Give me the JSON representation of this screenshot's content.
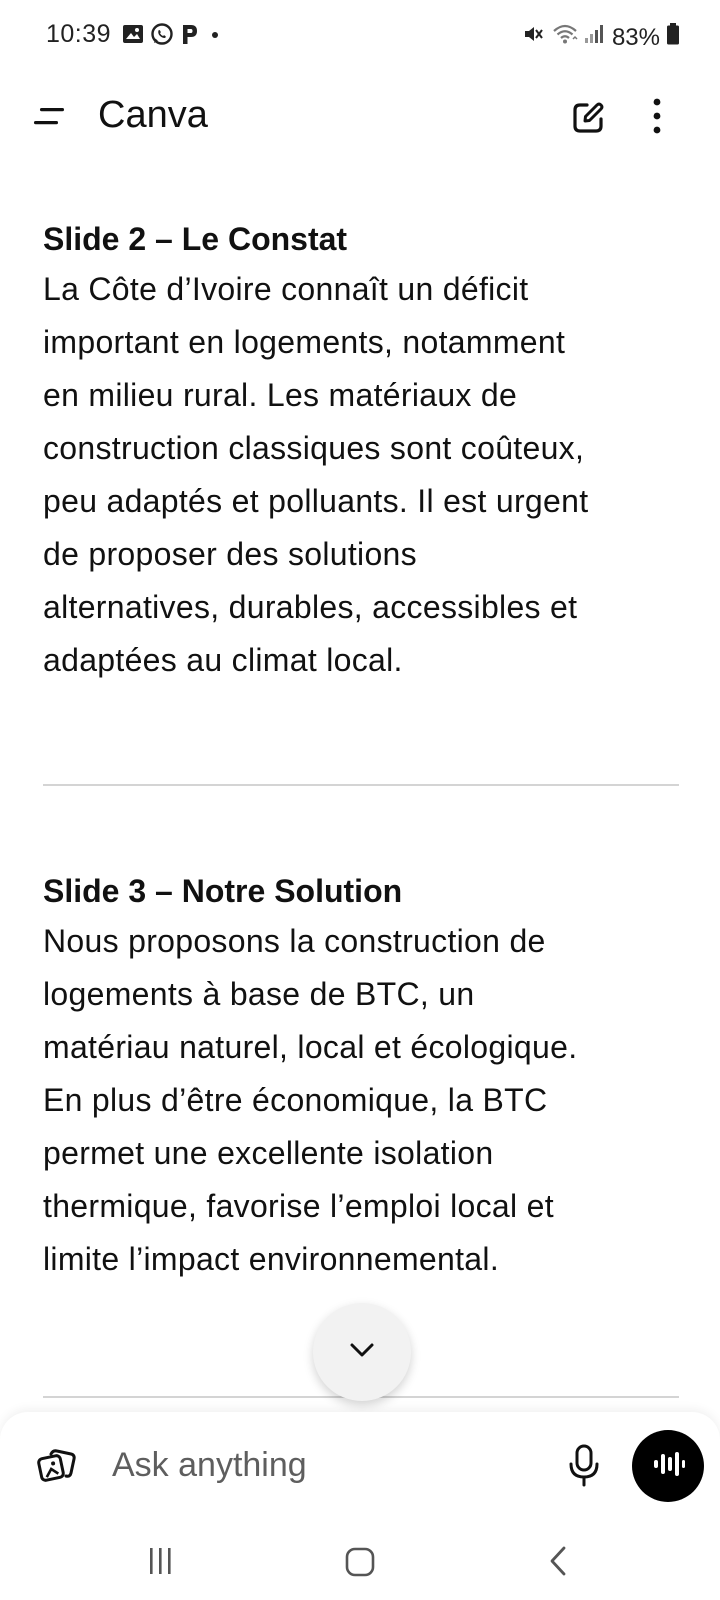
{
  "status_bar": {
    "time": "10:39",
    "battery": "83%",
    "left_icons": [
      "gallery-icon",
      "whatsapp-icon",
      "p-icon",
      "dot-icon"
    ],
    "right_icons": [
      "mute-icon",
      "wifi-icon",
      "signal-icon",
      "battery-icon"
    ]
  },
  "app_bar": {
    "title": "Canva",
    "menu_icon": "menu-icon",
    "edit_icon": "edit-icon",
    "more_icon": "more-vertical-icon"
  },
  "sections": [
    {
      "title": "Slide 2 – Le Constat",
      "lines": [
        "La Côte d’Ivoire connaît un déficit",
        "important en logements, notamment",
        "en milieu rural. Les matériaux de",
        "construction classiques sont coûteux,",
        "peu adaptés et polluants. Il est urgent",
        "de proposer des solutions",
        "alternatives, durables, accessibles et",
        "adaptées au climat local."
      ]
    },
    {
      "title": "Slide 3 – Notre Solution",
      "lines": [
        "Nous proposons la construction de",
        "logements à base de BTC, un",
        "matériau naturel, local et écologique.",
        "En plus d’être économique, la BTC",
        "permet une excellente isolation",
        "thermique, favorise l’emploi local et",
        "limite l’impact environnemental."
      ]
    }
  ],
  "scroll_button": {
    "icon": "chevron-down-icon"
  },
  "composer": {
    "placeholder": "Ask anything",
    "value": "",
    "attach_icon": "image-attach-icon",
    "mic_icon": "microphone-icon",
    "voice_icon": "voice-waveform-icon"
  },
  "nav_bar": {
    "icons": [
      "recent-apps-icon",
      "home-icon",
      "back-icon"
    ]
  },
  "colors": {
    "background": "#ffffff",
    "text": "#111111",
    "divider": "#d4d4d4",
    "voice_button": "#000000",
    "scroll_button": "#f2f2f2"
  }
}
